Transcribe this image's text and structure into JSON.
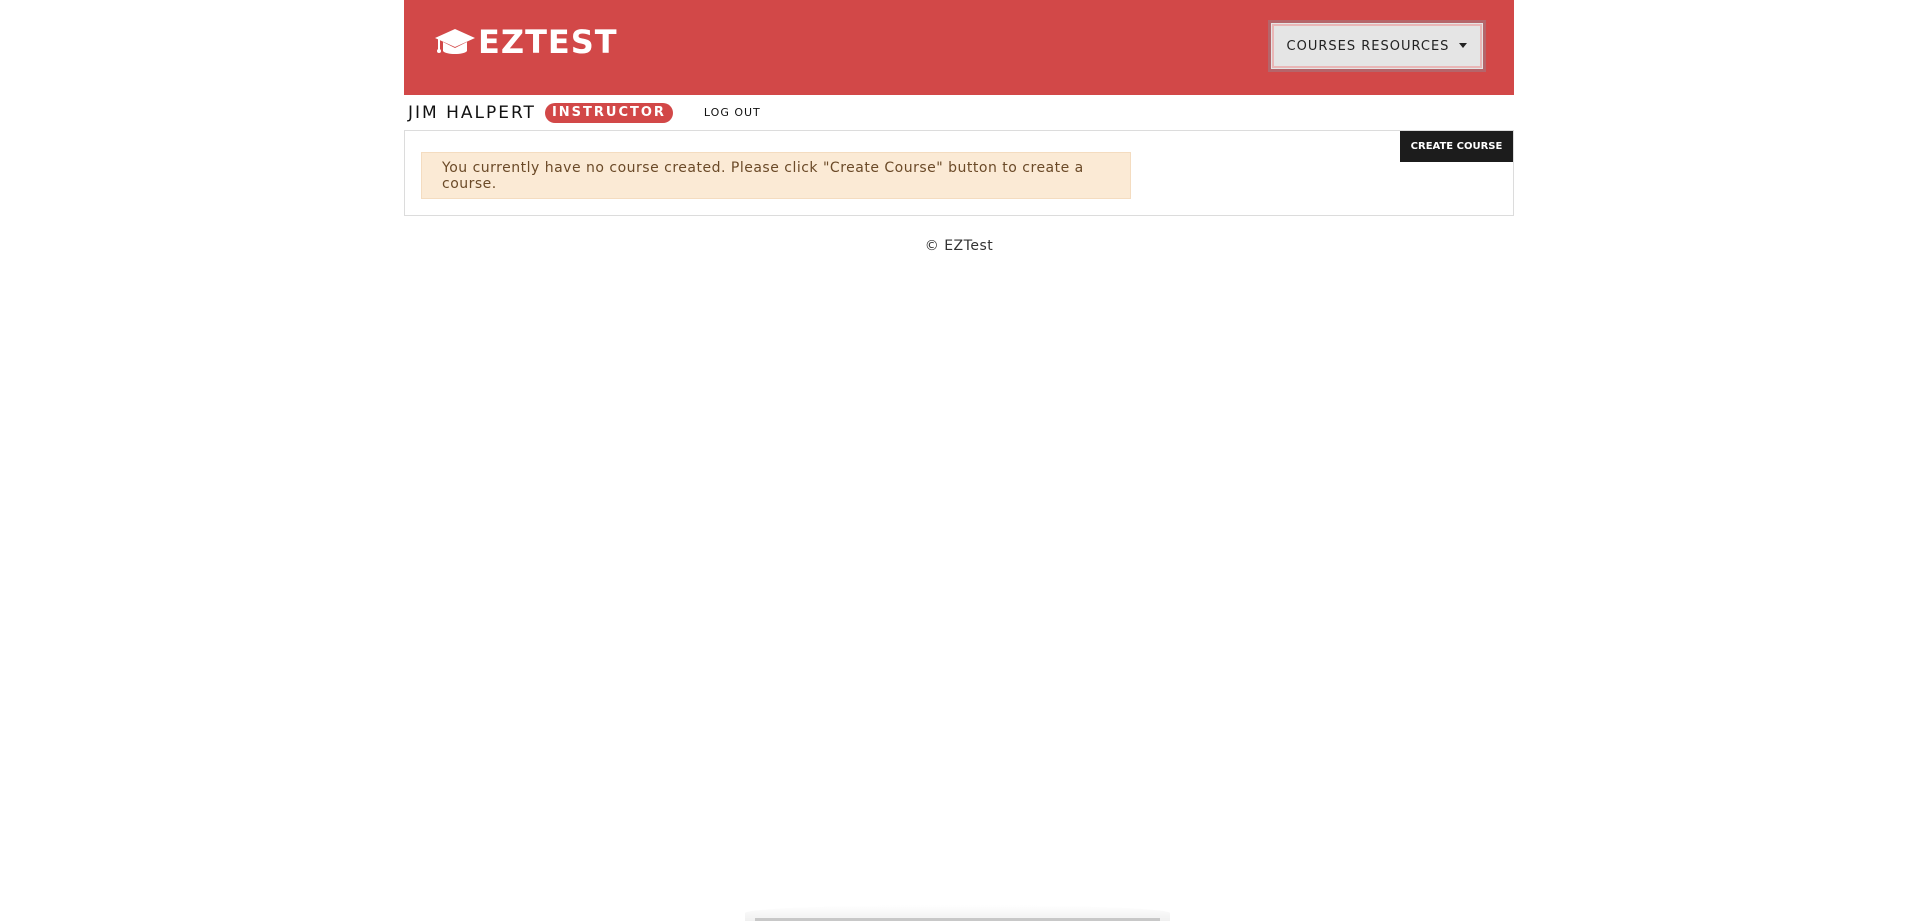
{
  "header": {
    "brand": "EZTEST",
    "brand_color": "#d24848",
    "icon": "graduation-cap-icon",
    "menu_label": "COURSES RESOURCES",
    "menu_icon": "caret-down-icon"
  },
  "user": {
    "name": "JIM HALPERT",
    "role": "INSTRUCTOR",
    "logout_label": "LOG OUT"
  },
  "courses": {
    "create_label": "CREATE COURSE",
    "empty_message": "You currently have no course created. Please click \"Create Course\" button to create a course."
  },
  "footer": {
    "text": "© EZTest"
  }
}
